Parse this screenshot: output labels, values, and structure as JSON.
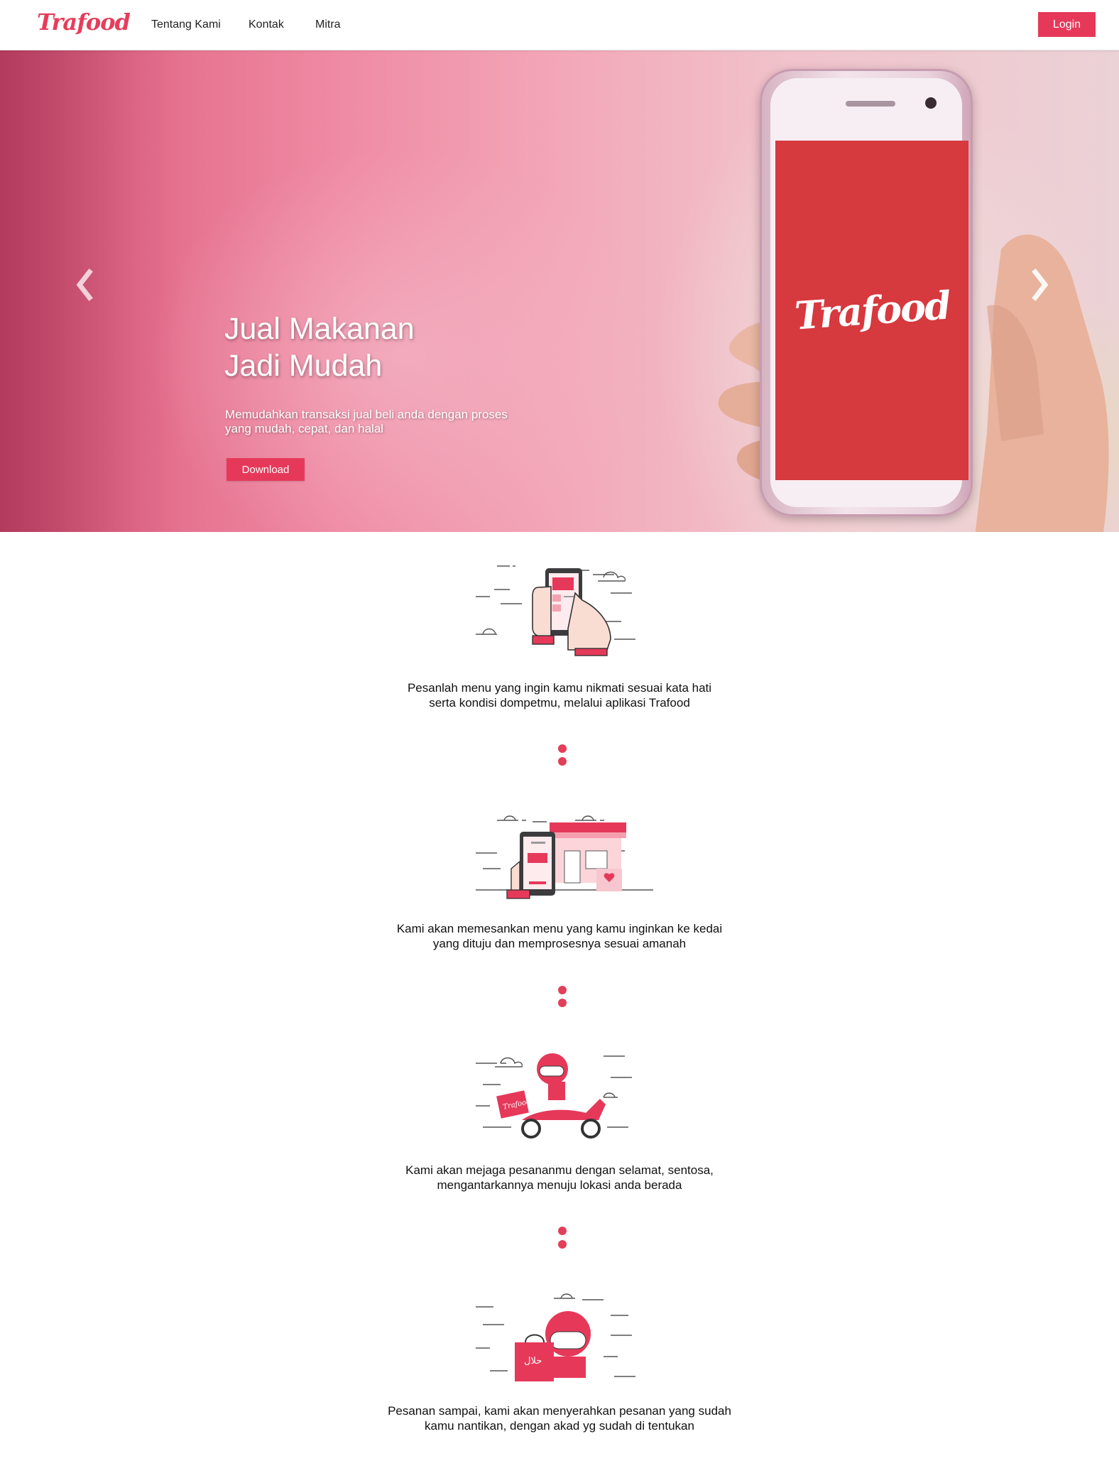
{
  "nav": {
    "logo": "Trafood",
    "links": [
      "Tentang Kami",
      "Kontak",
      "Mitra"
    ],
    "login_label": "Login"
  },
  "hero": {
    "title_line1": "Jual Makanan",
    "title_line2": "Jadi Mudah",
    "subtitle_line1": "Memudahkan transaksi jual beli anda dengan proses",
    "subtitle_line2": "yang mudah, cepat, dan halal",
    "download_label": "Download",
    "phone_logo": "Trafood"
  },
  "steps": [
    {
      "line1": "Pesanlah menu yang ingin kamu nikmati sesuai kata hati",
      "line2": "serta kondisi dompetmu, melalui aplikasi Trafood"
    },
    {
      "line1": "Kami akan memesankan menu yang kamu inginkan ke kedai",
      "line2": "yang dituju dan memprosesnya sesuai amanah"
    },
    {
      "line1": "Kami akan mejaga pesananmu dengan selamat, sentosa,",
      "line2": "mengantarkannya menuju lokasi anda berada"
    },
    {
      "line1": "Pesanan sampai, kami akan menyerahkan pesanan yang sudah",
      "line2": "kamu nantikan, dengan akad yg sudah di tentukan"
    }
  ],
  "illustration_text": {
    "box_logo": "Trafood",
    "halal": "حلال"
  },
  "colors": {
    "brand": "#e6395a",
    "phone_screen": "#d6393e",
    "dot": "#e23f58"
  }
}
